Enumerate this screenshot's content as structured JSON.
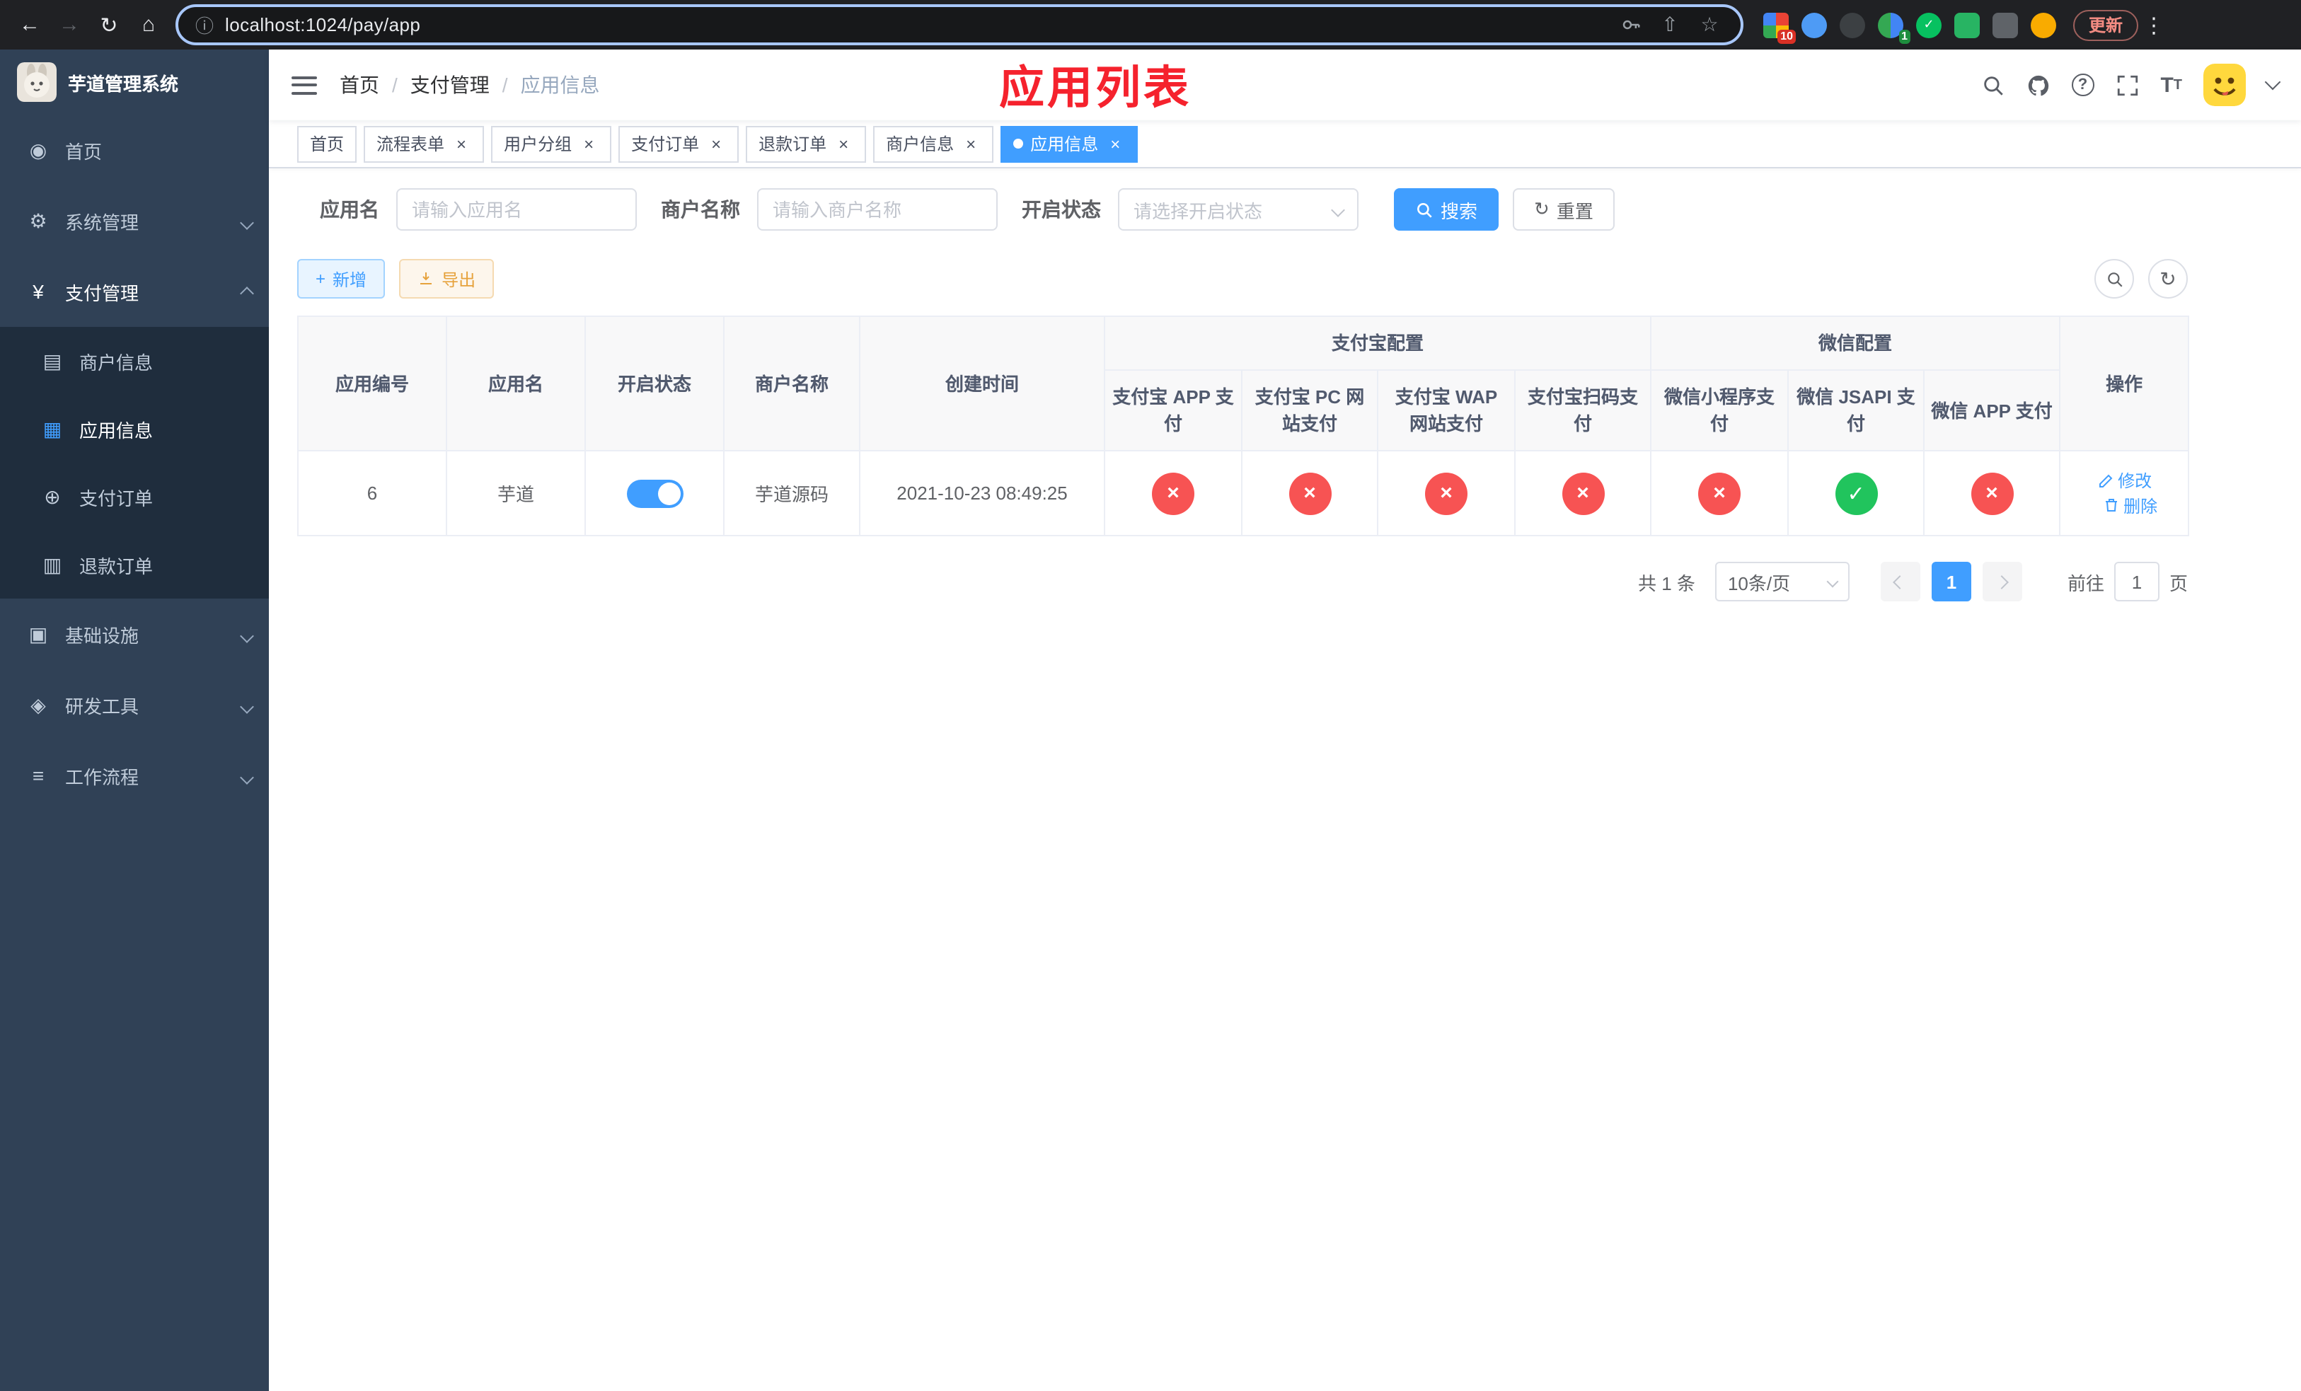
{
  "browser": {
    "url": "localhost:1024/pay/app",
    "update_button": "更新",
    "ext_badge_grid": "10",
    "ext_badge_profile": "1"
  },
  "icons": {
    "back": "←",
    "forward": "→",
    "reload": "↻",
    "home": "⌂",
    "info": "ⓘ",
    "share": "⇧",
    "star": "☆",
    "menu_dots": "⋮",
    "help": "?",
    "font_size_big": "T",
    "font_size_small": "T",
    "dashboard": "◉",
    "gear": "⚙",
    "yen": "¥",
    "merchant": "▤",
    "app_grid": "▦",
    "pay_order": "⊕",
    "refund": "▥",
    "infra": "▣",
    "tools": "◈",
    "workflow": "≡",
    "check": "✓",
    "cross": "×",
    "plus": "+",
    "refresh": "↻"
  },
  "sidebar": {
    "title": "芋道管理系统",
    "home": "首页",
    "system": "系统管理",
    "payment": "支付管理",
    "merchant_info": "商户信息",
    "app_info": "应用信息",
    "pay_order": "支付订单",
    "refund_order": "退款订单",
    "infrastructure": "基础设施",
    "dev_tools": "研发工具",
    "workflow": "工作流程"
  },
  "navbar": {
    "breadcrumb_home": "首页",
    "breadcrumb_section": "支付管理",
    "breadcrumb_current": "应用信息",
    "separator": "/",
    "page_heading": "应用列表"
  },
  "tabs": [
    {
      "label": "首页",
      "closable": false,
      "active": false
    },
    {
      "label": "流程表单",
      "closable": true,
      "active": false
    },
    {
      "label": "用户分组",
      "closable": true,
      "active": false
    },
    {
      "label": "支付订单",
      "closable": true,
      "active": false
    },
    {
      "label": "退款订单",
      "closable": true,
      "active": false
    },
    {
      "label": "商户信息",
      "closable": true,
      "active": false
    },
    {
      "label": "应用信息",
      "closable": true,
      "active": true
    }
  ],
  "filters": {
    "app_name_label": "应用名",
    "app_name_placeholder": "请输入应用名",
    "merchant_label": "商户名称",
    "merchant_placeholder": "请输入商户名称",
    "status_label": "开启状态",
    "status_placeholder": "请选择开启状态",
    "search_button": "搜索",
    "reset_button": "重置"
  },
  "toolbar": {
    "add_button": "新增",
    "export_button": "导出"
  },
  "table": {
    "headers": {
      "app_id": "应用编号",
      "app_name": "应用名",
      "status": "开启状态",
      "merchant_name": "商户名称",
      "create_time": "创建时间",
      "alipay_group": "支付宝配置",
      "wechat_group": "微信配置",
      "alipay_app": "支付宝 APP 支付",
      "alipay_pc": "支付宝 PC 网站支付",
      "alipay_wap": "支付宝 WAP 网站支付",
      "alipay_qr": "支付宝扫码支付",
      "wechat_lite": "微信小程序支付",
      "wechat_jsapi": "微信 JSAPI 支付",
      "wechat_app": "微信 APP 支付",
      "actions": "操作"
    },
    "row": {
      "app_id": "6",
      "app_name": "芋道",
      "status_on": true,
      "merchant_name": "芋道源码",
      "create_time": "2021-10-23 08:49:25",
      "alipay_app": "disabled",
      "alipay_pc": "disabled",
      "alipay_wap": "disabled",
      "alipay_qr": "disabled",
      "wechat_lite": "disabled",
      "wechat_jsapi": "enabled",
      "wechat_app": "disabled",
      "edit_label": "修改",
      "delete_label": "删除"
    }
  },
  "pagination": {
    "total": "共 1 条",
    "page_size": "10条/页",
    "page": "1",
    "goto_label": "前往",
    "goto_value": "1",
    "page_unit": "页"
  },
  "colors": {
    "primary": "#409eff",
    "danger": "#f75353",
    "success": "#21c45d",
    "heading_red": "#f5222d",
    "sidebar_bg": "#304156",
    "submenu_bg": "#1f2d3d"
  }
}
